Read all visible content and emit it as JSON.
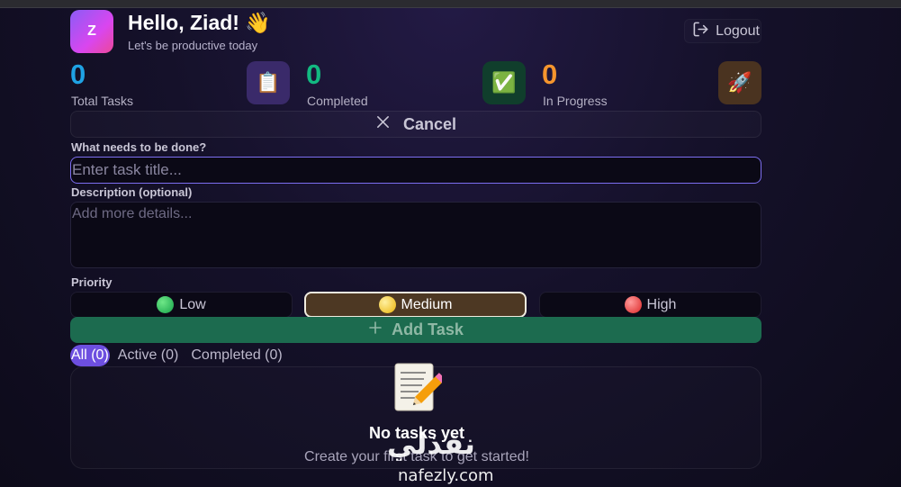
{
  "header": {
    "avatar_initial": "Z",
    "greeting": "Hello, Ziad! 👋",
    "subtitle": "Let's be productive today",
    "logout_label": "Logout"
  },
  "stats": [
    {
      "value": "0",
      "label": "Total Tasks",
      "icon": "📋",
      "color": "#1fa2e4",
      "icon_bg": "#3a2a6a"
    },
    {
      "value": "0",
      "label": "Completed",
      "icon": "✅",
      "color": "#12b981",
      "icon_bg": "#103e2c"
    },
    {
      "value": "0",
      "label": "In Progress",
      "icon": "🚀",
      "color": "#f5952d",
      "icon_bg": "#4a3320"
    }
  ],
  "form": {
    "cancel_label": "Cancel",
    "title_label": "What needs to be done?",
    "title_placeholder": "Enter task title...",
    "title_value": "",
    "desc_label": "Description (optional)",
    "desc_placeholder": "Add more details...",
    "desc_value": "",
    "priority_label": "Priority",
    "priorities": [
      {
        "label": "Low",
        "emoji": "🟢",
        "color": "#22c55e",
        "selected": false
      },
      {
        "label": "Medium",
        "emoji": "🟡",
        "color": "#facc15",
        "selected": true
      },
      {
        "label": "High",
        "emoji": "🔴",
        "color": "#ef4444",
        "selected": false
      }
    ],
    "add_label": "Add Task"
  },
  "filters": [
    {
      "label": "All (0)",
      "active": true
    },
    {
      "label": "Active (0)",
      "active": false
    },
    {
      "label": "Completed (0)",
      "active": false
    }
  ],
  "empty_state": {
    "icon": "memo-icon",
    "title": "No tasks yet",
    "subtitle": "Create your first task to get started!"
  },
  "watermark": {
    "arabic": "نفذلي",
    "latin": "nafezly.com"
  },
  "colors": {
    "accent": "#6d4fe0",
    "add_button": "#1c6b4f",
    "input_focus": "#7c6ef0"
  }
}
